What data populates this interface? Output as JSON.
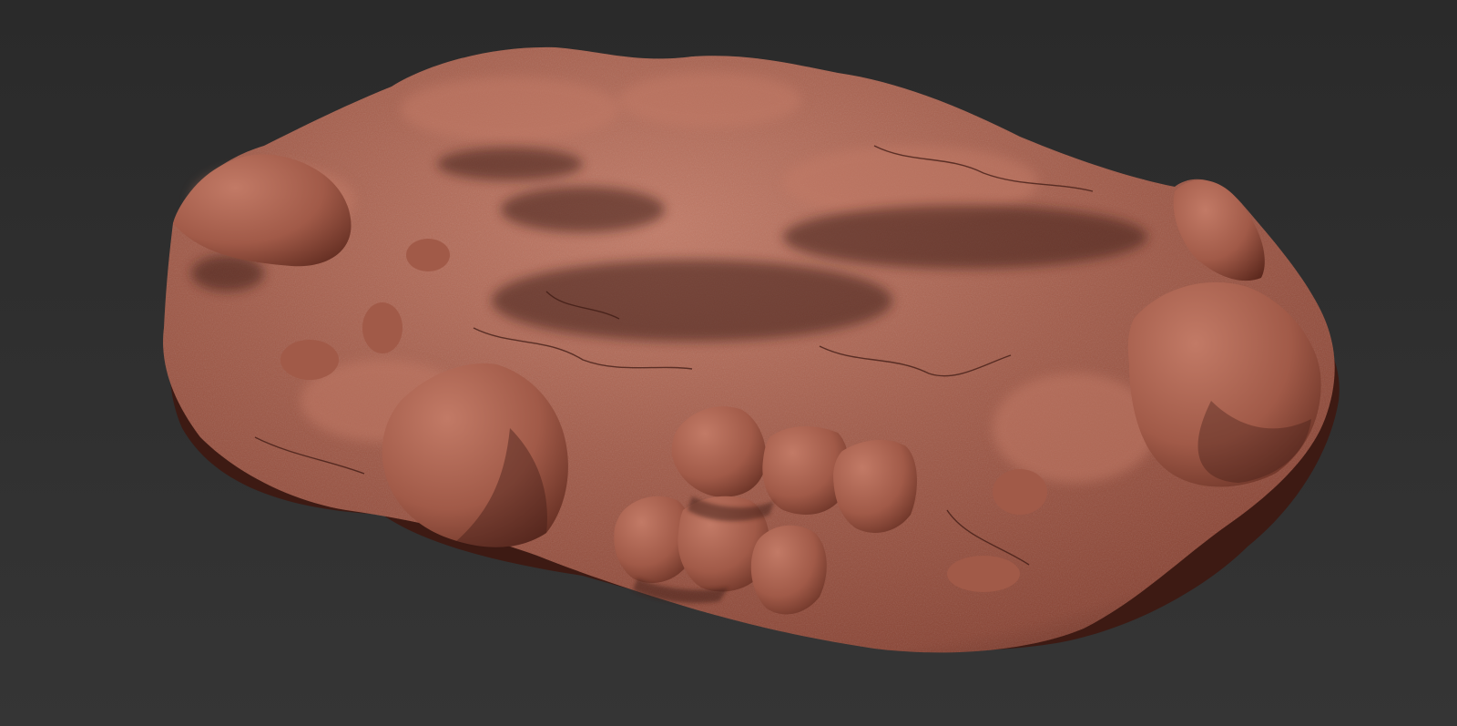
{
  "viewport": {
    "background_top": "#2a2a2a",
    "background_bottom": "#353535",
    "object": "sculpted-rock-base-mesh"
  },
  "material": {
    "name": "clay-red",
    "base": "#8a4434",
    "light": "#c27a66",
    "mid": "#a15a48",
    "dark": "#5a271c",
    "shadow": "#3d1a13"
  }
}
